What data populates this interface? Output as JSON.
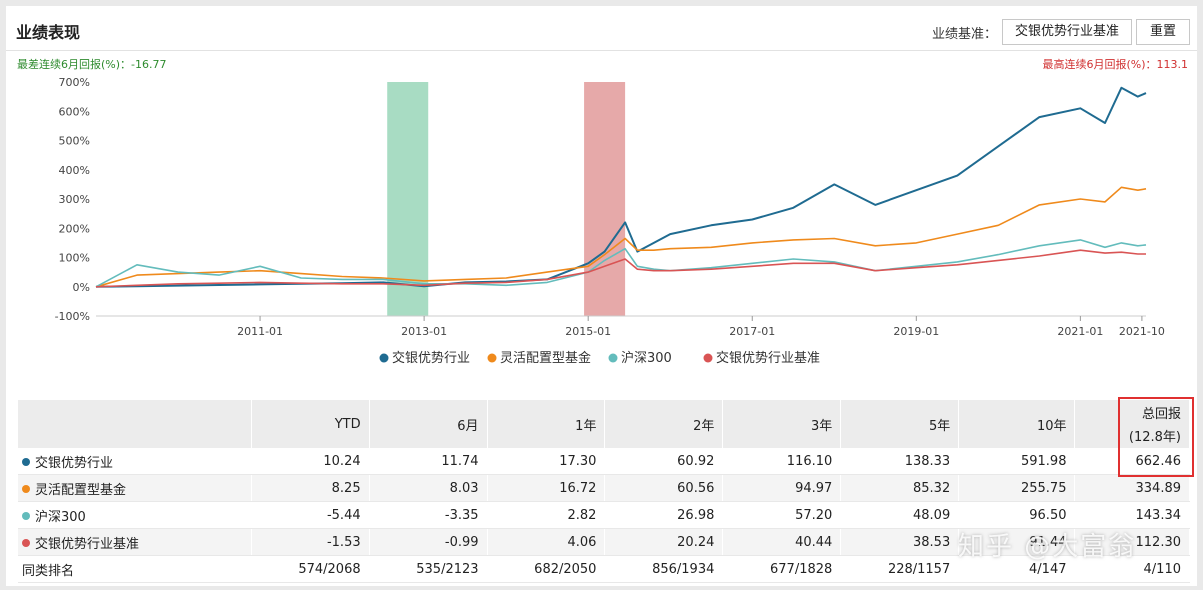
{
  "header": {
    "title": "业绩表现",
    "benchmark_label": "业绩基准：",
    "benchmark_button": "交银优势行业基准",
    "reset_button": "重置"
  },
  "drawdown": {
    "worst_text": "最差连续6月回报(%)：-16.77",
    "best_text": "最高连续6月回报(%)：113.1"
  },
  "colors": {
    "fund": "#1f6b91",
    "peer": "#ef8a1c",
    "csi300": "#63bcbc",
    "bench": "#d95454",
    "worst_band": "#9fd8bd",
    "best_band": "#e3a0a0",
    "highlight": "#e03030"
  },
  "chart_data": {
    "type": "line",
    "x_ticks": [
      "2011-01",
      "2013-01",
      "2015-01",
      "2017-01",
      "2019-01",
      "2021-01",
      "2021-10"
    ],
    "y_ticks": [
      "700%",
      "600%",
      "500%",
      "400%",
      "300%",
      "200%",
      "100%",
      "0%",
      "-100%"
    ],
    "ylim": [
      -100,
      700
    ],
    "x_range": [
      2009.0,
      2021.8
    ],
    "worst_period": [
      2012.55,
      2013.05
    ],
    "best_period": [
      2014.95,
      2015.45
    ],
    "legend": [
      "交银优势行业",
      "灵活配置型基金",
      "沪深300",
      "交银优势行业基准"
    ],
    "x": [
      2009.0,
      2009.5,
      2010.0,
      2010.5,
      2011.0,
      2011.5,
      2012.0,
      2012.5,
      2013.0,
      2013.5,
      2014.0,
      2014.5,
      2015.0,
      2015.2,
      2015.45,
      2015.6,
      2015.8,
      2016.0,
      2016.5,
      2017.0,
      2017.5,
      2018.0,
      2018.5,
      2019.0,
      2019.5,
      2020.0,
      2020.5,
      2021.0,
      2021.3,
      2021.5,
      2021.7,
      2021.8
    ],
    "series": [
      {
        "name": "交银优势行业",
        "key": "fund",
        "values": [
          0,
          2,
          4,
          6,
          8,
          10,
          12,
          15,
          2,
          15,
          18,
          25,
          80,
          120,
          220,
          120,
          150,
          180,
          210,
          230,
          270,
          350,
          280,
          330,
          380,
          480,
          580,
          610,
          560,
          680,
          650,
          662
        ]
      },
      {
        "name": "灵活配置型基金",
        "key": "peer",
        "values": [
          0,
          40,
          45,
          50,
          55,
          45,
          35,
          30,
          20,
          25,
          30,
          50,
          70,
          110,
          165,
          125,
          125,
          130,
          135,
          150,
          160,
          165,
          140,
          150,
          180,
          210,
          280,
          300,
          290,
          340,
          330,
          335
        ]
      },
      {
        "name": "沪深300",
        "key": "csi300",
        "values": [
          0,
          75,
          50,
          40,
          70,
          30,
          25,
          25,
          10,
          10,
          5,
          15,
          50,
          90,
          130,
          70,
          60,
          55,
          65,
          80,
          95,
          85,
          55,
          70,
          85,
          110,
          140,
          160,
          135,
          150,
          140,
          143
        ]
      },
      {
        "name": "交银优势行业基准",
        "key": "bench",
        "values": [
          0,
          5,
          10,
          12,
          15,
          12,
          10,
          10,
          5,
          12,
          15,
          25,
          50,
          70,
          95,
          60,
          55,
          55,
          60,
          70,
          80,
          80,
          55,
          65,
          75,
          90,
          105,
          125,
          115,
          118,
          112,
          112
        ]
      }
    ]
  },
  "table": {
    "columns": [
      "YTD",
      "6月",
      "1年",
      "2年",
      "3年",
      "5年",
      "10年"
    ],
    "total_header": "总回报",
    "total_period": "(12.8年)",
    "rows": [
      {
        "name": "交银优势行业",
        "key": "fund",
        "values": [
          "10.24",
          "11.74",
          "17.30",
          "60.92",
          "116.10",
          "138.33",
          "591.98",
          "662.46"
        ]
      },
      {
        "name": "灵活配置型基金",
        "key": "peer",
        "values": [
          "8.25",
          "8.03",
          "16.72",
          "60.56",
          "94.97",
          "85.32",
          "255.75",
          "334.89"
        ]
      },
      {
        "name": "沪深300",
        "key": "csi300",
        "values": [
          "-5.44",
          "-3.35",
          "2.82",
          "26.98",
          "57.20",
          "48.09",
          "96.50",
          "143.34"
        ]
      },
      {
        "name": "交银优势行业基准",
        "key": "bench",
        "values": [
          "-1.53",
          "-0.99",
          "4.06",
          "20.24",
          "40.44",
          "38.53",
          "91.44",
          "112.30"
        ]
      }
    ],
    "rank_row": {
      "name": "同类排名",
      "values": [
        "574/2068",
        "535/2123",
        "682/2050",
        "856/1934",
        "677/1828",
        "228/1157",
        "4/147",
        "4/110"
      ]
    }
  },
  "watermark": "知乎 @大富翁"
}
